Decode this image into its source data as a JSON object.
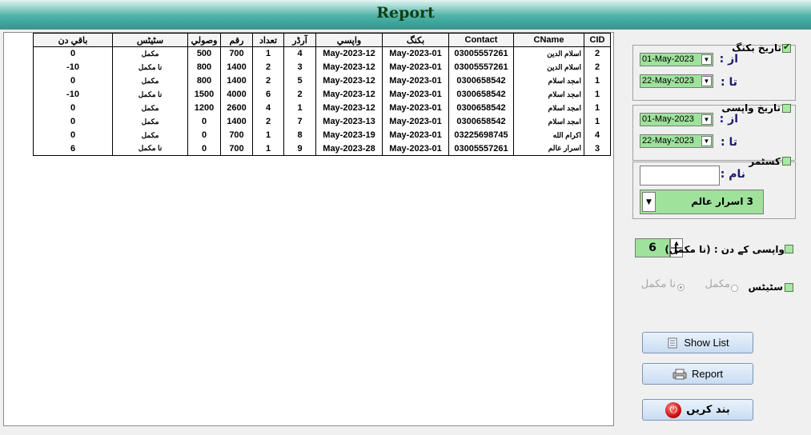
{
  "window": {
    "title": "Report"
  },
  "table": {
    "columns": [
      "CID",
      "CName",
      "Contact",
      "بکنگ",
      "واپسي",
      "آرڈر",
      "تعداد",
      "رقم",
      "وصولي",
      "سٹیٹس",
      "باقي دن"
    ],
    "rows": [
      [
        "2",
        "اسلام الدين",
        "03005557261",
        "May-2023-01",
        "May-2023-12",
        "4",
        "1",
        "700",
        "500",
        "مکمل",
        "0"
      ],
      [
        "2",
        "اسلام الدين",
        "03005557261",
        "May-2023-01",
        "May-2023-12",
        "3",
        "2",
        "1400",
        "800",
        "نا مکمل",
        "-10"
      ],
      [
        "1",
        "امجد اسلام",
        "0300658542",
        "May-2023-01",
        "May-2023-12",
        "5",
        "2",
        "1400",
        "800",
        "مکمل",
        "0"
      ],
      [
        "1",
        "امجد اسلام",
        "0300658542",
        "May-2023-01",
        "May-2023-12",
        "2",
        "6",
        "4000",
        "1500",
        "نا مکمل",
        "-10"
      ],
      [
        "1",
        "امجد اسلام",
        "0300658542",
        "May-2023-01",
        "May-2023-12",
        "1",
        "4",
        "2600",
        "1200",
        "مکمل",
        "0"
      ],
      [
        "1",
        "امجد اسلام",
        "0300658542",
        "May-2023-01",
        "May-2023-13",
        "7",
        "2",
        "1400",
        "0",
        "مکمل",
        "0"
      ],
      [
        "4",
        "اکرام الله",
        "03225698745",
        "May-2023-01",
        "May-2023-19",
        "8",
        "1",
        "700",
        "0",
        "مکمل",
        "0"
      ],
      [
        "3",
        "اسرار عالم",
        "03005557261",
        "May-2023-01",
        "May-2023-28",
        "9",
        "1",
        "700",
        "0",
        "نا مکمل",
        "6"
      ]
    ]
  },
  "booking_date": {
    "label": "تاریخ بکنگ",
    "checked": true,
    "from_label": "از :",
    "from": "01-May-2023",
    "to_label": "تا :",
    "to": "22-May-2023"
  },
  "return_date": {
    "label": "تاریخ واپسی",
    "checked": false,
    "from_label": "از :",
    "from": "01-May-2023",
    "to_label": "تا :",
    "to": "22-May-2023"
  },
  "customer": {
    "label": "کسٹمر",
    "checked": false,
    "name_label": "نام :",
    "name_value": "",
    "selected": "3   اسرار عالم"
  },
  "return_days": {
    "label": "واپسی کے دن : (نا مکمل)",
    "value": "6",
    "checked": false
  },
  "status": {
    "label": "سٹیٹس",
    "checked": false,
    "options": [
      "مکمل",
      "نا مکمل"
    ],
    "selected": "نا مکمل"
  },
  "buttons": {
    "show_list": "Show List",
    "report": "Report",
    "close": "بند کریں"
  },
  "colors": {
    "accent_green": "#9ee29c",
    "title_teal": "#2e9a90",
    "title_text": "#0f3f14"
  }
}
